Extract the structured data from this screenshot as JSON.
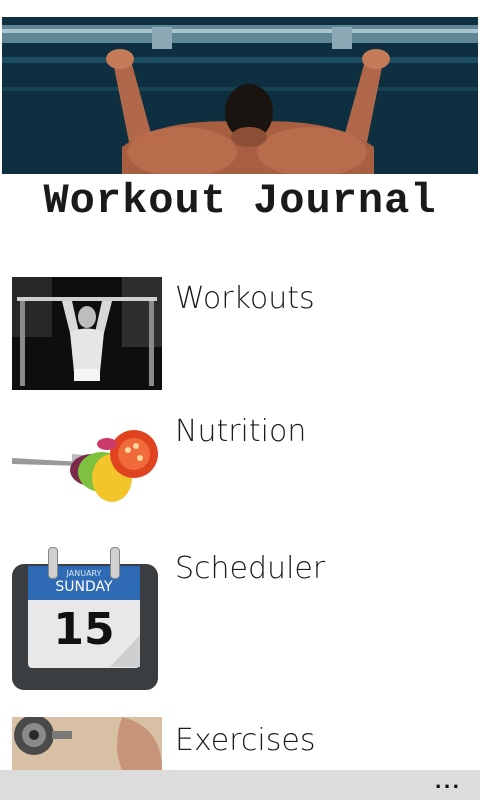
{
  "app": {
    "title": "Workout Journal"
  },
  "menu": {
    "items": [
      {
        "label": "Workouts",
        "icon": "pull-up-athlete-icon"
      },
      {
        "label": "Nutrition",
        "icon": "salad-fork-icon"
      },
      {
        "label": "Scheduler",
        "icon": "calendar-icon"
      },
      {
        "label": "Exercises",
        "icon": "dumbbell-icon"
      }
    ]
  },
  "calendar": {
    "month": "JANUARY",
    "weekday": "SUNDAY",
    "day": "15"
  },
  "app_bar": {
    "more_label": "..."
  },
  "colors": {
    "background": "#ffffff",
    "app_bar": "#dcdcdc",
    "title_text": "#1a1a1a",
    "calendar_header": "#2f6bb5"
  }
}
